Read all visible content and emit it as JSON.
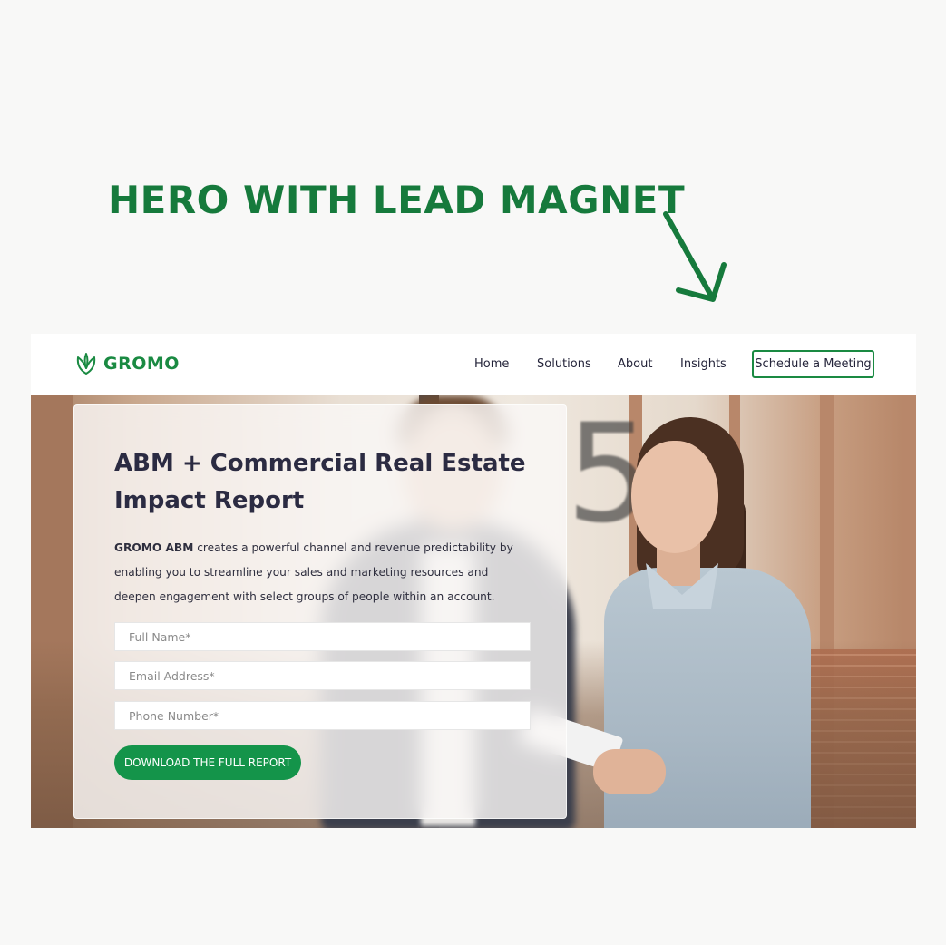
{
  "annotation": {
    "title": "HERO WITH LEAD MAGNET",
    "arrow_icon": "arrow-down-right-icon"
  },
  "brand": {
    "name": "GROMO",
    "logo_icon": "leaf-logo-icon",
    "color": "#1a8a42"
  },
  "nav": {
    "links": [
      "Home",
      "Solutions",
      "About",
      "Insights"
    ],
    "cta_label": "Schedule a Meeting"
  },
  "hero": {
    "title": "ABM + Commercial Real Estate Impact Report",
    "description_brand": "GROMO ABM",
    "description": " creates a powerful channel and revenue predictability by enabling you to streamline your sales and marketing resources and deepen engagement with select groups of people within an account.",
    "background_number": "5",
    "form": {
      "full_name_placeholder": "Full Name*",
      "email_placeholder": "Email Address*",
      "phone_placeholder": "Phone Number*",
      "submit_label": "DOWNLOAD THE FULL REPORT"
    }
  },
  "colors": {
    "accent": "#167a3c",
    "button": "#14944a",
    "heading": "#2b2b42"
  }
}
